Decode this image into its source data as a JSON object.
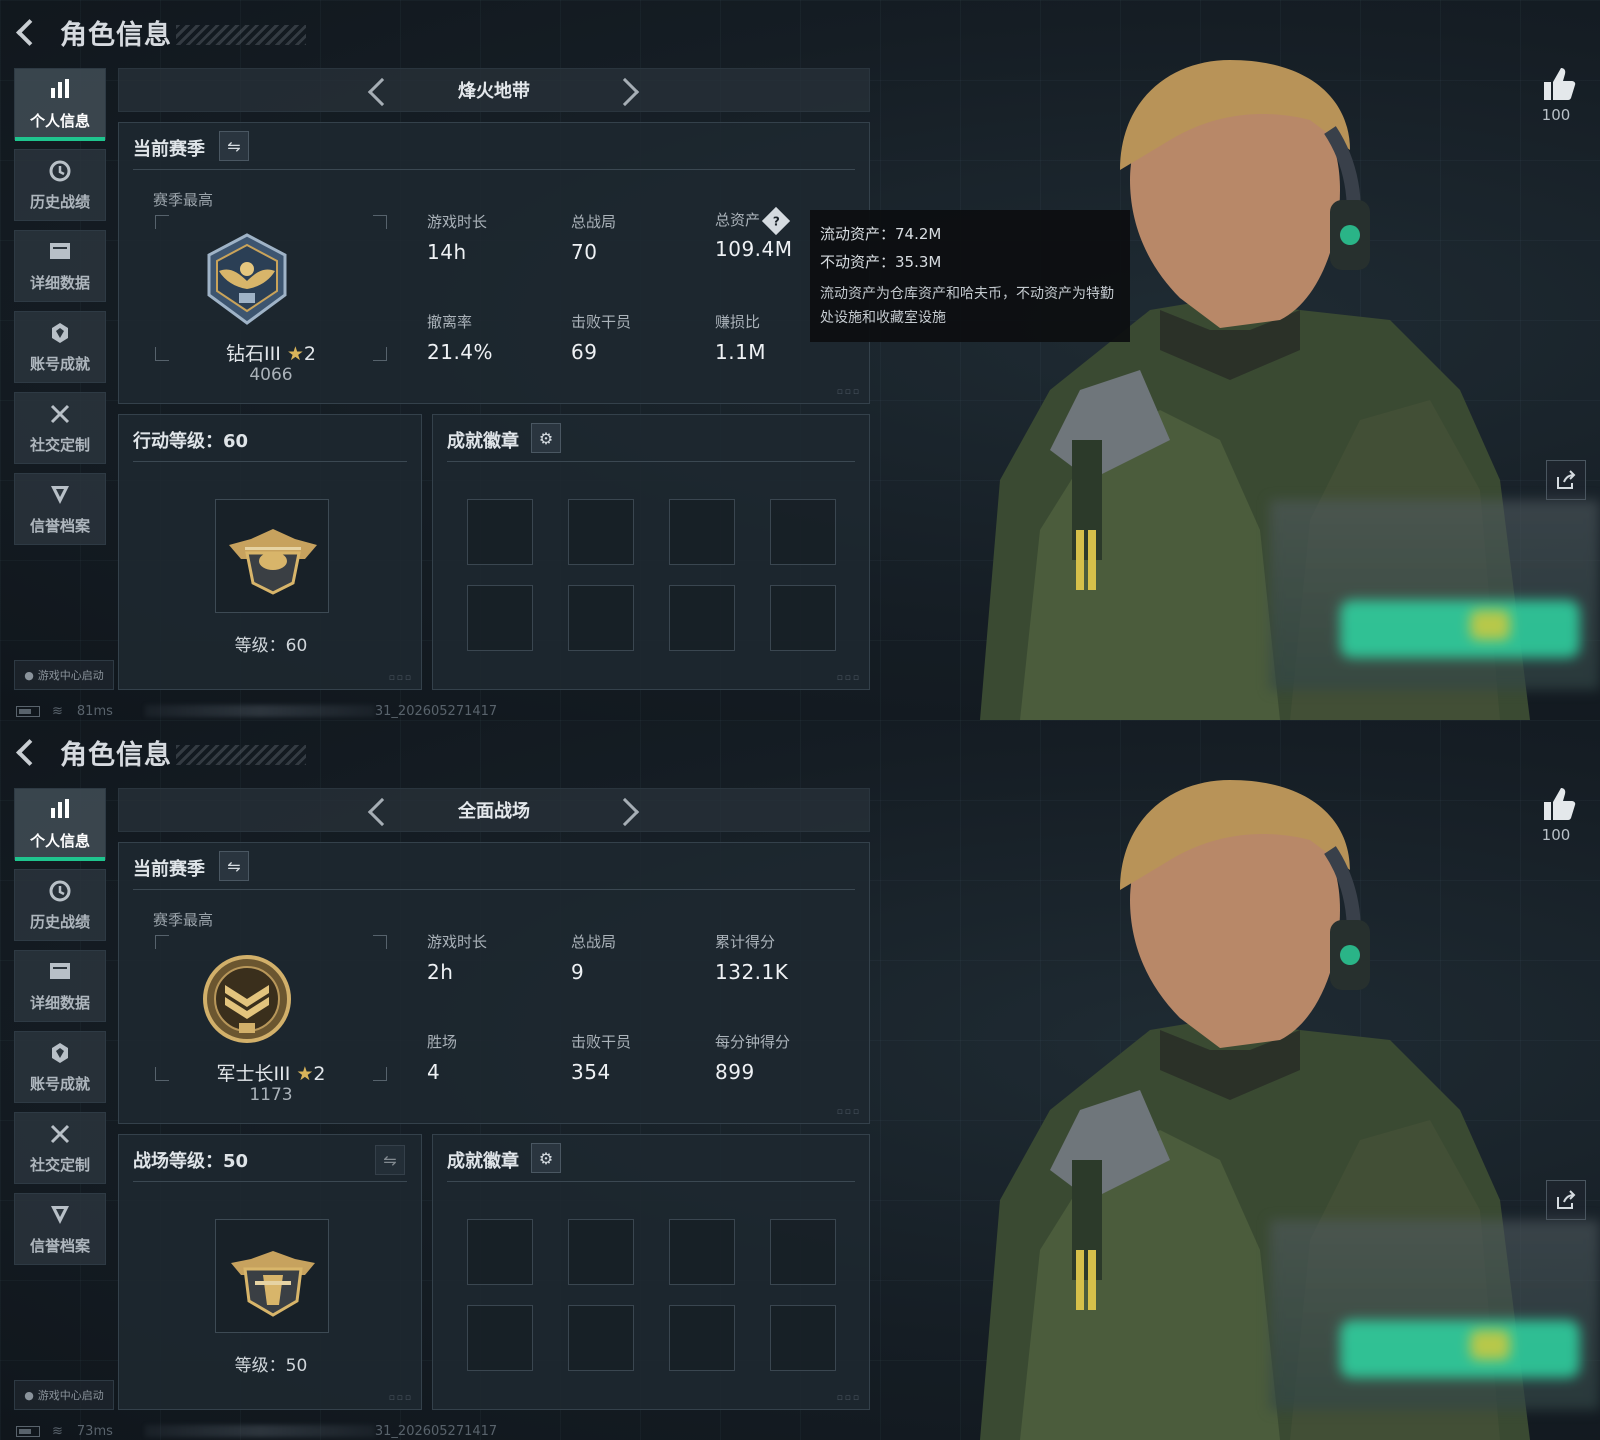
{
  "screens": [
    {
      "header": {
        "title": "角色信息"
      },
      "sidebar": {
        "items": [
          {
            "label": "个人信息",
            "icon": "bar-chart-icon"
          },
          {
            "label": "历史战绩",
            "icon": "clock-icon"
          },
          {
            "label": "详细数据",
            "icon": "folder-icon"
          },
          {
            "label": "账号成就",
            "icon": "achievement-icon"
          },
          {
            "label": "社交定制",
            "icon": "tools-icon"
          },
          {
            "label": "信誉档案",
            "icon": "shield-icon"
          }
        ]
      },
      "launch_badge": "游戏中心启动",
      "status": {
        "ping": "81ms",
        "version": "31_202605271417"
      },
      "mode": {
        "name": "烽火地带"
      },
      "season": {
        "title": "当前赛季",
        "subtitle": "赛季最高",
        "rank_name": "钻石III",
        "rank_stars": "2",
        "rank_score": "4066",
        "stats": [
          {
            "label": "游戏时长",
            "value": "14h"
          },
          {
            "label": "总战局",
            "value": "70"
          },
          {
            "label": "总资产",
            "value": "109.4M",
            "help": "?"
          },
          {
            "label": "撤离率",
            "value": "21.4%"
          },
          {
            "label": "击败干员",
            "value": "69"
          },
          {
            "label": "赚损比",
            "value": "1.1M"
          }
        ]
      },
      "tooltip": {
        "liquid": "流动资产：74.2M",
        "fixed": "不动资产：35.3M",
        "desc": "流动资产为仓库资产和哈夫币，不动资产为特勤处设施和收藏室设施"
      },
      "level": {
        "title": "行动等级：60",
        "caption": "等级：60"
      },
      "badges": {
        "title": "成就徽章"
      },
      "likes": "100"
    },
    {
      "header": {
        "title": "角色信息"
      },
      "sidebar": {
        "items": [
          {
            "label": "个人信息",
            "icon": "bar-chart-icon"
          },
          {
            "label": "历史战绩",
            "icon": "clock-icon"
          },
          {
            "label": "详细数据",
            "icon": "folder-icon"
          },
          {
            "label": "账号成就",
            "icon": "achievement-icon"
          },
          {
            "label": "社交定制",
            "icon": "tools-icon"
          },
          {
            "label": "信誉档案",
            "icon": "shield-icon"
          }
        ]
      },
      "launch_badge": "游戏中心启动",
      "status": {
        "ping": "73ms",
        "version": "31_202605271417"
      },
      "mode": {
        "name": "全面战场"
      },
      "season": {
        "title": "当前赛季",
        "subtitle": "赛季最高",
        "rank_name": "军士长III",
        "rank_stars": "2",
        "rank_score": "1173",
        "stats": [
          {
            "label": "游戏时长",
            "value": "2h"
          },
          {
            "label": "总战局",
            "value": "9"
          },
          {
            "label": "累计得分",
            "value": "132.1K"
          },
          {
            "label": "胜场",
            "value": "4"
          },
          {
            "label": "击败干员",
            "value": "354"
          },
          {
            "label": "每分钟得分",
            "value": "899"
          }
        ]
      },
      "level": {
        "title": "战场等级：50",
        "caption": "等级：50"
      },
      "badges": {
        "title": "成就徽章"
      },
      "likes": "100"
    }
  ]
}
